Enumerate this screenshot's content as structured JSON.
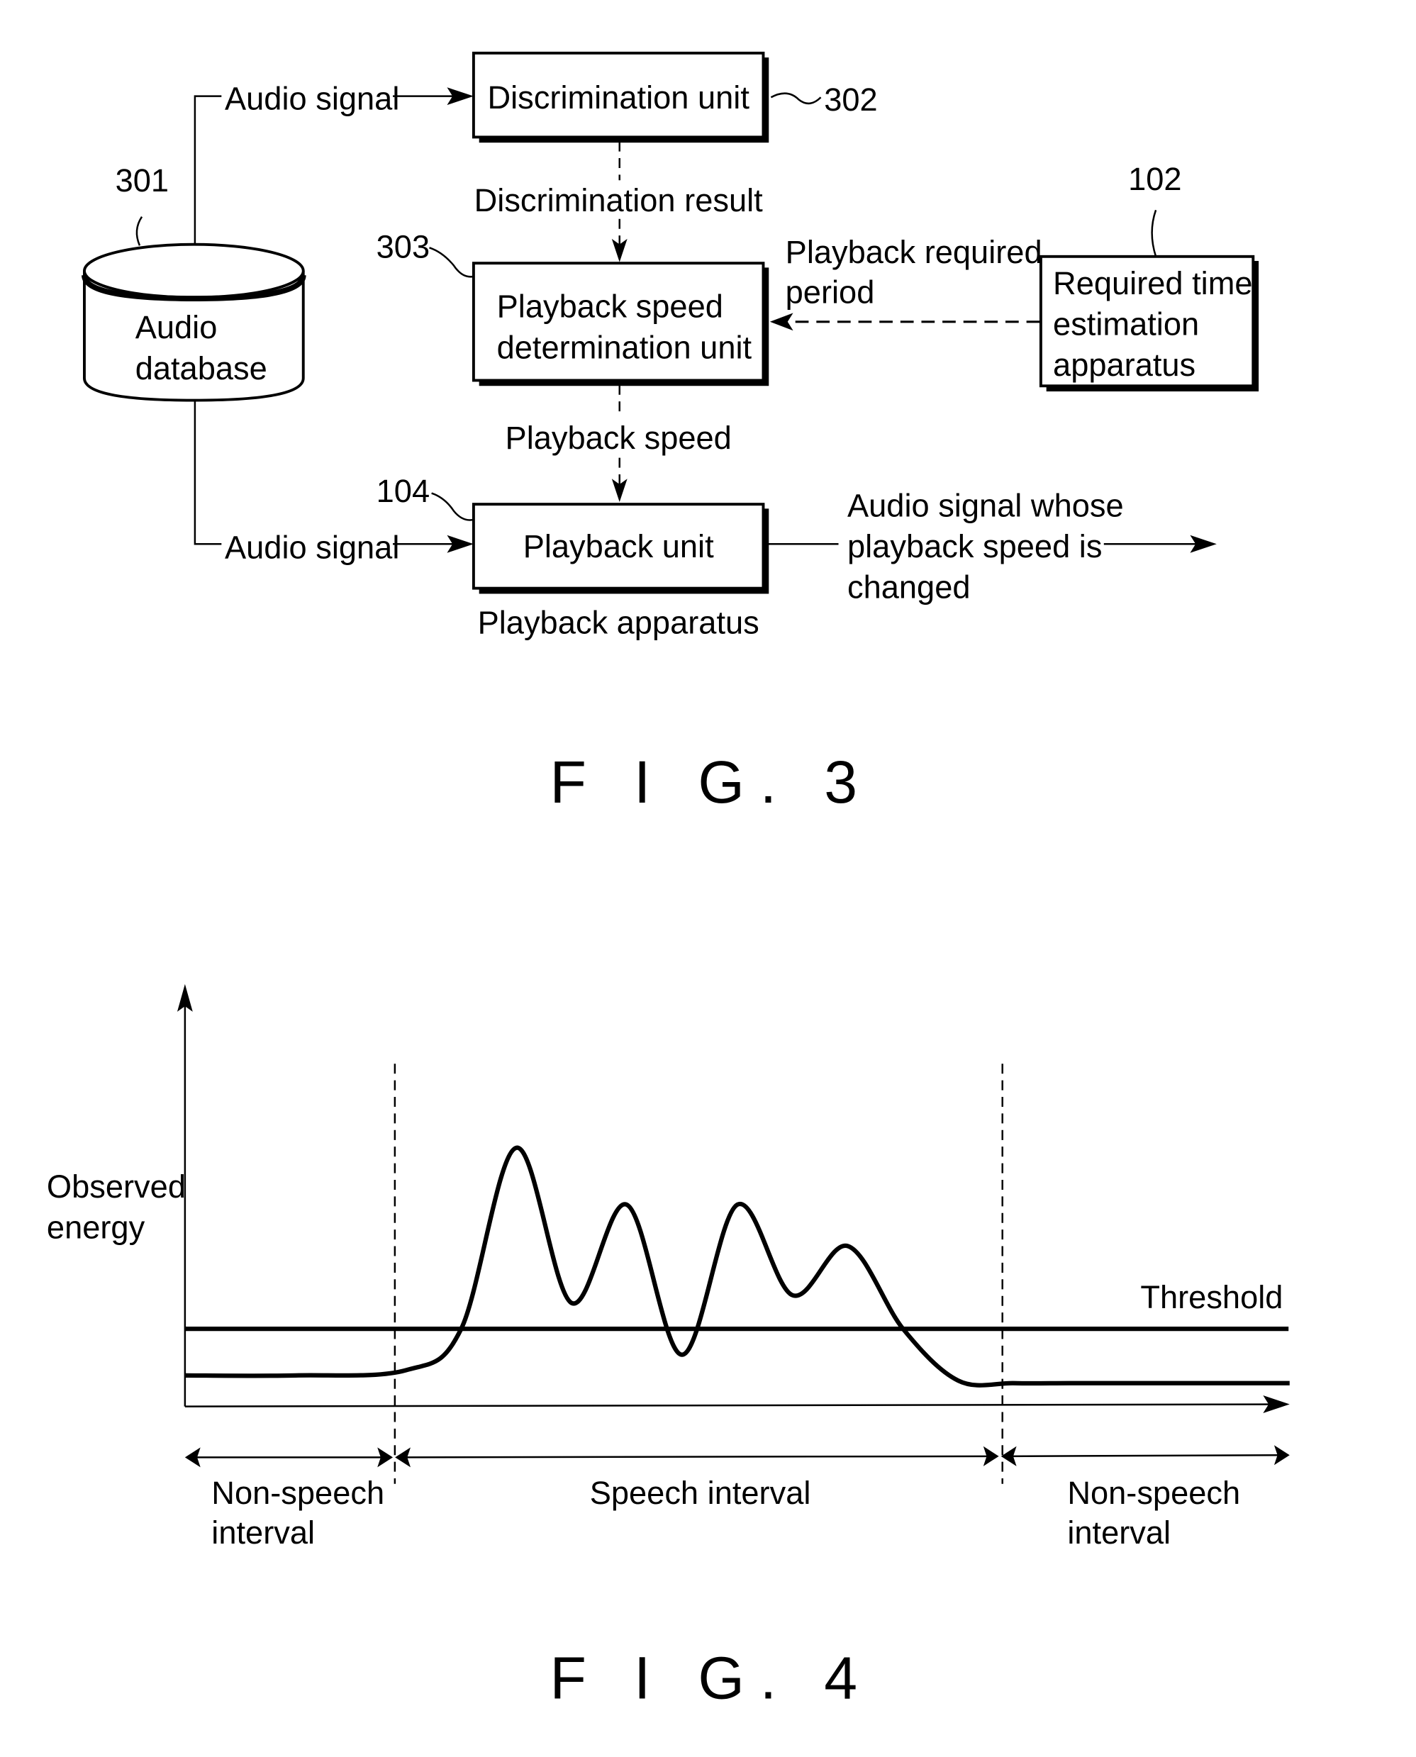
{
  "fig3": {
    "caption": "F I G. 3",
    "audio_database": {
      "ref": "301",
      "line1": "Audio",
      "line2": "database"
    },
    "discrimination_unit": {
      "ref": "302",
      "label": "Discrimination unit"
    },
    "playback_speed_determination_unit": {
      "ref": "303",
      "line1": "Playback speed",
      "line2": "determination unit"
    },
    "required_time_estimation_apparatus": {
      "ref": "102",
      "line1": "Required time",
      "line2": "estimation",
      "line3": "apparatus"
    },
    "playback_unit": {
      "ref": "104",
      "label": "Playback unit"
    },
    "playback_apparatus_label": "Playback apparatus",
    "edges": {
      "audio_signal_top": "Audio signal",
      "audio_signal_bottom": "Audio signal",
      "discrimination_result": "Discrimination result",
      "playback_required_period_line1": "Playback required",
      "playback_required_period_line2": "period",
      "playback_speed": "Playback speed",
      "output_line1": "Audio signal whose",
      "output_line2": "playback speed is",
      "output_line3": "changed"
    }
  },
  "fig4": {
    "caption": "F I G. 4",
    "y_axis_label_line1": "Observed",
    "y_axis_label_line2": "energy",
    "threshold_label": "Threshold",
    "intervals": [
      {
        "line1": "Non-speech",
        "line2": "interval"
      },
      {
        "line1": "Speech interval",
        "line2": ""
      },
      {
        "line1": "Non-speech",
        "line2": "interval"
      }
    ]
  },
  "chart_data": {
    "type": "line",
    "title": "",
    "xlabel": "",
    "ylabel": "Observed energy",
    "x_ticks": [],
    "y_ticks": [],
    "grid": false,
    "threshold": {
      "label": "Threshold",
      "value": 0.3
    },
    "series": [
      {
        "name": "Observed energy",
        "x": [
          0,
          10,
          20,
          25,
          30,
          35,
          40,
          45,
          50,
          55,
          60,
          65,
          70,
          75,
          80,
          85,
          90,
          95,
          100
        ],
        "y": [
          0.12,
          0.12,
          0.14,
          0.3,
          1.0,
          0.4,
          0.78,
          0.2,
          0.78,
          0.43,
          0.62,
          0.3,
          0.1,
          0.09,
          0.09,
          0.09,
          0.09,
          0.09,
          0.09
        ]
      }
    ],
    "speech_interval_bounds": [
      19,
      74
    ],
    "interval_labels": [
      "Non-speech interval",
      "Speech interval",
      "Non-speech interval"
    ]
  }
}
